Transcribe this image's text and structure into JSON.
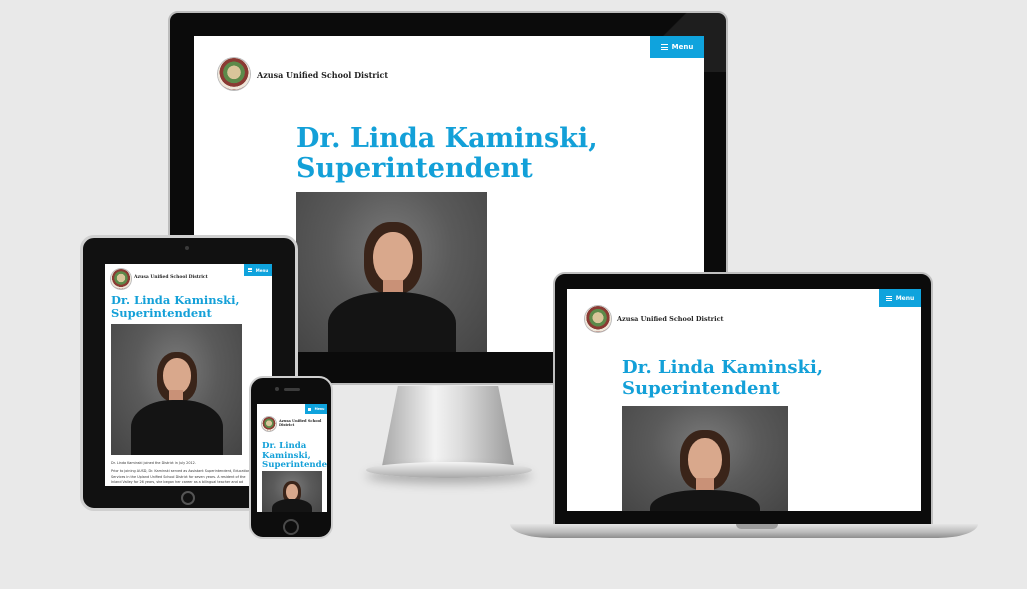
{
  "site": {
    "name": "Azusa Unified School District",
    "name_line1": "Azusa Unified School",
    "name_line2": "District",
    "menu_label": "Menu",
    "heading_line1": "Dr. Linda Kaminski,",
    "heading_line2": "Superintendent",
    "heading_phone_line1": "Dr. Linda",
    "heading_phone_line2": "Kaminski,",
    "heading_phone_line3": "Superintendent",
    "bio_p1": "Dr. Linda Kaminski joined the District in July 2012.",
    "bio_p2_l1": "Prior to joining AUSD, Dr. Kaminski served as Assistant Superintendent, Educational",
    "bio_p2_l2": "Services in the Upland Unified School District for seven years. A resident of the",
    "bio_p2_l3": "Inland Valley for 26 years, she began her career as a bilingual teacher and ad"
  },
  "colors": {
    "accent": "#0fa3dd",
    "heading": "#13a0d8",
    "background": "#e9e9e9"
  },
  "icons": [
    "menu-icon",
    "district-seal-logo"
  ]
}
